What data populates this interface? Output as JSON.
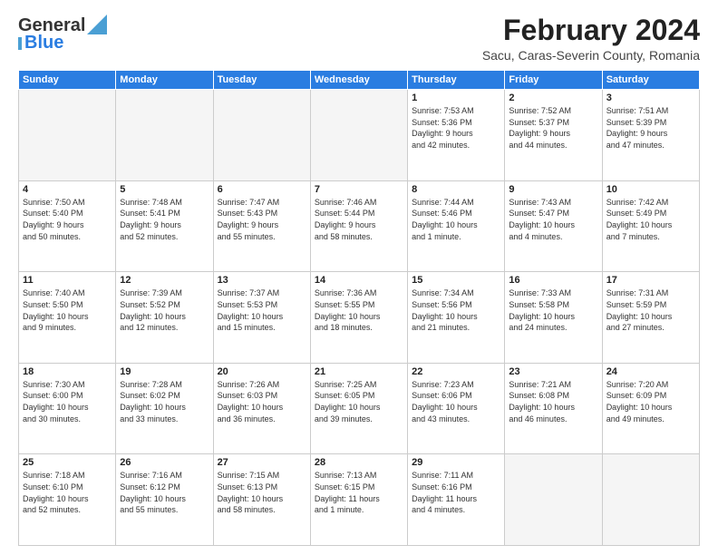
{
  "logo": {
    "line1": "General",
    "line2": "Blue"
  },
  "header": {
    "month": "February 2024",
    "location": "Sacu, Caras-Severin County, Romania"
  },
  "weekdays": [
    "Sunday",
    "Monday",
    "Tuesday",
    "Wednesday",
    "Thursday",
    "Friday",
    "Saturday"
  ],
  "weeks": [
    [
      {
        "day": "",
        "info": ""
      },
      {
        "day": "",
        "info": ""
      },
      {
        "day": "",
        "info": ""
      },
      {
        "day": "",
        "info": ""
      },
      {
        "day": "1",
        "info": "Sunrise: 7:53 AM\nSunset: 5:36 PM\nDaylight: 9 hours\nand 42 minutes."
      },
      {
        "day": "2",
        "info": "Sunrise: 7:52 AM\nSunset: 5:37 PM\nDaylight: 9 hours\nand 44 minutes."
      },
      {
        "day": "3",
        "info": "Sunrise: 7:51 AM\nSunset: 5:39 PM\nDaylight: 9 hours\nand 47 minutes."
      }
    ],
    [
      {
        "day": "4",
        "info": "Sunrise: 7:50 AM\nSunset: 5:40 PM\nDaylight: 9 hours\nand 50 minutes."
      },
      {
        "day": "5",
        "info": "Sunrise: 7:48 AM\nSunset: 5:41 PM\nDaylight: 9 hours\nand 52 minutes."
      },
      {
        "day": "6",
        "info": "Sunrise: 7:47 AM\nSunset: 5:43 PM\nDaylight: 9 hours\nand 55 minutes."
      },
      {
        "day": "7",
        "info": "Sunrise: 7:46 AM\nSunset: 5:44 PM\nDaylight: 9 hours\nand 58 minutes."
      },
      {
        "day": "8",
        "info": "Sunrise: 7:44 AM\nSunset: 5:46 PM\nDaylight: 10 hours\nand 1 minute."
      },
      {
        "day": "9",
        "info": "Sunrise: 7:43 AM\nSunset: 5:47 PM\nDaylight: 10 hours\nand 4 minutes."
      },
      {
        "day": "10",
        "info": "Sunrise: 7:42 AM\nSunset: 5:49 PM\nDaylight: 10 hours\nand 7 minutes."
      }
    ],
    [
      {
        "day": "11",
        "info": "Sunrise: 7:40 AM\nSunset: 5:50 PM\nDaylight: 10 hours\nand 9 minutes."
      },
      {
        "day": "12",
        "info": "Sunrise: 7:39 AM\nSunset: 5:52 PM\nDaylight: 10 hours\nand 12 minutes."
      },
      {
        "day": "13",
        "info": "Sunrise: 7:37 AM\nSunset: 5:53 PM\nDaylight: 10 hours\nand 15 minutes."
      },
      {
        "day": "14",
        "info": "Sunrise: 7:36 AM\nSunset: 5:55 PM\nDaylight: 10 hours\nand 18 minutes."
      },
      {
        "day": "15",
        "info": "Sunrise: 7:34 AM\nSunset: 5:56 PM\nDaylight: 10 hours\nand 21 minutes."
      },
      {
        "day": "16",
        "info": "Sunrise: 7:33 AM\nSunset: 5:58 PM\nDaylight: 10 hours\nand 24 minutes."
      },
      {
        "day": "17",
        "info": "Sunrise: 7:31 AM\nSunset: 5:59 PM\nDaylight: 10 hours\nand 27 minutes."
      }
    ],
    [
      {
        "day": "18",
        "info": "Sunrise: 7:30 AM\nSunset: 6:00 PM\nDaylight: 10 hours\nand 30 minutes."
      },
      {
        "day": "19",
        "info": "Sunrise: 7:28 AM\nSunset: 6:02 PM\nDaylight: 10 hours\nand 33 minutes."
      },
      {
        "day": "20",
        "info": "Sunrise: 7:26 AM\nSunset: 6:03 PM\nDaylight: 10 hours\nand 36 minutes."
      },
      {
        "day": "21",
        "info": "Sunrise: 7:25 AM\nSunset: 6:05 PM\nDaylight: 10 hours\nand 39 minutes."
      },
      {
        "day": "22",
        "info": "Sunrise: 7:23 AM\nSunset: 6:06 PM\nDaylight: 10 hours\nand 43 minutes."
      },
      {
        "day": "23",
        "info": "Sunrise: 7:21 AM\nSunset: 6:08 PM\nDaylight: 10 hours\nand 46 minutes."
      },
      {
        "day": "24",
        "info": "Sunrise: 7:20 AM\nSunset: 6:09 PM\nDaylight: 10 hours\nand 49 minutes."
      }
    ],
    [
      {
        "day": "25",
        "info": "Sunrise: 7:18 AM\nSunset: 6:10 PM\nDaylight: 10 hours\nand 52 minutes."
      },
      {
        "day": "26",
        "info": "Sunrise: 7:16 AM\nSunset: 6:12 PM\nDaylight: 10 hours\nand 55 minutes."
      },
      {
        "day": "27",
        "info": "Sunrise: 7:15 AM\nSunset: 6:13 PM\nDaylight: 10 hours\nand 58 minutes."
      },
      {
        "day": "28",
        "info": "Sunrise: 7:13 AM\nSunset: 6:15 PM\nDaylight: 11 hours\nand 1 minute."
      },
      {
        "day": "29",
        "info": "Sunrise: 7:11 AM\nSunset: 6:16 PM\nDaylight: 11 hours\nand 4 minutes."
      },
      {
        "day": "",
        "info": ""
      },
      {
        "day": "",
        "info": ""
      }
    ]
  ]
}
